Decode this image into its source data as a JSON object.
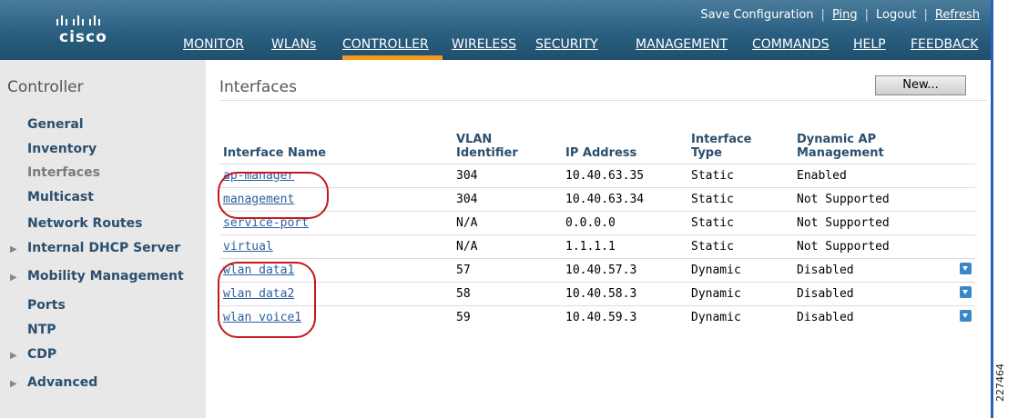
{
  "header": {
    "brand": "cisco",
    "links": [
      "Save Configuration",
      "Ping",
      "Logout",
      "Refresh"
    ],
    "nav": [
      "MONITOR",
      "WLANs",
      "CONTROLLER",
      "WIRELESS",
      "SECURITY",
      "MANAGEMENT",
      "COMMANDS",
      "HELP",
      "FEEDBACK"
    ],
    "active_nav": "CONTROLLER"
  },
  "sidebar": {
    "title": "Controller",
    "items": [
      {
        "label": "General"
      },
      {
        "label": "Inventory"
      },
      {
        "label": "Interfaces",
        "active": true
      },
      {
        "label": "Multicast"
      },
      {
        "label": "Network Routes"
      },
      {
        "label": "Internal DHCP Server",
        "expandable": true
      },
      {
        "label": "Mobility Management",
        "expandable": true
      },
      {
        "label": "Ports"
      },
      {
        "label": "NTP"
      },
      {
        "label": "CDP",
        "expandable": true
      },
      {
        "label": "Advanced",
        "expandable": true
      }
    ]
  },
  "main": {
    "title": "Interfaces",
    "new_button": "New...",
    "columns": [
      "Interface Name",
      "VLAN Identifier",
      "IP Address",
      "Interface Type",
      "Dynamic AP Management"
    ],
    "rows": [
      {
        "name": "ap-manager",
        "vlan": "304",
        "ip": "10.40.63.35",
        "type": "Static",
        "dynamic": "Enabled",
        "menu": false
      },
      {
        "name": "management",
        "vlan": "304",
        "ip": "10.40.63.34",
        "type": "Static",
        "dynamic": "Not Supported",
        "menu": false
      },
      {
        "name": "service-port",
        "vlan": "N/A",
        "ip": "0.0.0.0",
        "type": "Static",
        "dynamic": "Not Supported",
        "menu": false
      },
      {
        "name": "virtual",
        "vlan": "N/A",
        "ip": "1.1.1.1",
        "type": "Static",
        "dynamic": "Not Supported",
        "menu": false
      },
      {
        "name": "wlan data1",
        "vlan": "57",
        "ip": "10.40.57.3",
        "type": "Dynamic",
        "dynamic": "Disabled",
        "menu": true
      },
      {
        "name": "wlan data2",
        "vlan": "58",
        "ip": "10.40.58.3",
        "type": "Dynamic",
        "dynamic": "Disabled",
        "menu": true
      },
      {
        "name": "wlan voice1",
        "vlan": "59",
        "ip": "10.40.59.3",
        "type": "Dynamic",
        "dynamic": "Disabled",
        "menu": true
      }
    ]
  },
  "figure_number": "227464",
  "colors": {
    "header": "#2b5f80",
    "accent": "#f29b1f",
    "link": "#2b5f9e",
    "annotation": "#c4161c"
  }
}
